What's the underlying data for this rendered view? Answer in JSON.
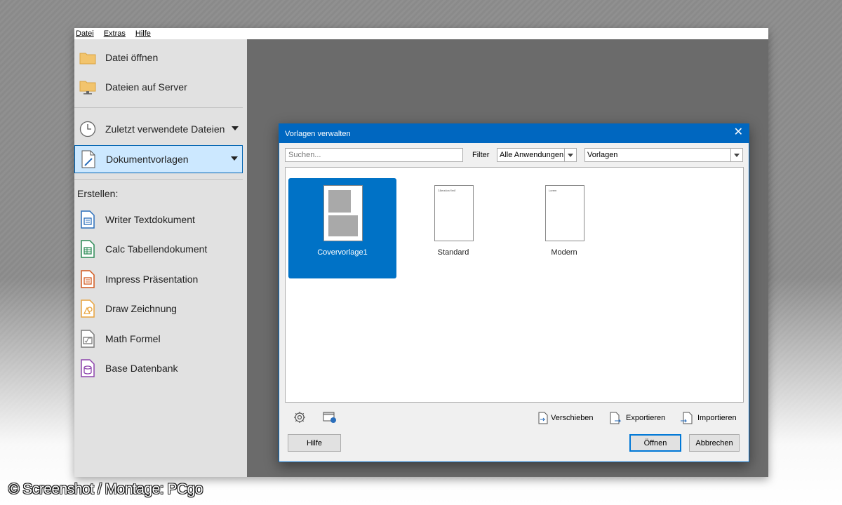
{
  "menubar": {
    "items": [
      "Datei",
      "Extras",
      "Hilfe"
    ]
  },
  "sidebar": {
    "open_file": "Datei öffnen",
    "remote_files": "Dateien auf Server",
    "recent_files": "Zuletzt verwendete Dateien",
    "templates": "Dokumentvorlagen",
    "create_label": "Erstellen:",
    "create_items": [
      {
        "label": "Writer Textdokument",
        "color": "#2a6ebb"
      },
      {
        "label": "Calc Tabellendokument",
        "color": "#2e8b57"
      },
      {
        "label": "Impress Präsentation",
        "color": "#d2591e"
      },
      {
        "label": "Draw Zeichnung",
        "color": "#e8a33d"
      },
      {
        "label": "Math Formel",
        "color": "#7a7a7a"
      },
      {
        "label": "Base Datenbank",
        "color": "#8e44ad"
      }
    ]
  },
  "dialog": {
    "title": "Vorlagen verwalten",
    "close_glyph": "✕",
    "search_placeholder": "Suchen...",
    "filter_label": "Filter",
    "app_filter_value": "Alle Anwendungen",
    "category_value": "Vorlagen",
    "templates": [
      {
        "name": "Covervorlage1",
        "selected": true
      },
      {
        "name": "Standard",
        "selected": false,
        "thumb_text": "Liberation Serif"
      },
      {
        "name": "Modern",
        "selected": false,
        "thumb_text": "Lorem"
      }
    ],
    "tools": {
      "move": "Verschieben",
      "export": "Exportieren",
      "import": "Importieren"
    },
    "buttons": {
      "help": "Hilfe",
      "open": "Öffnen",
      "cancel": "Abbrechen"
    }
  },
  "watermark": "© Screenshot / Montage: PCgo",
  "colors": {
    "accent": "#0067c0",
    "selection": "#0072c6",
    "sidebar_bg": "#e1e1e1",
    "backdrop": "#6b6b6b"
  }
}
